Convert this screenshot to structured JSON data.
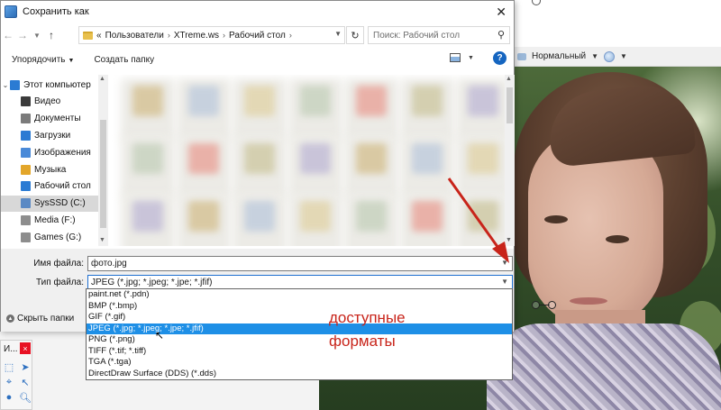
{
  "dialog": {
    "title": "Сохранить как",
    "address": {
      "crumbs": [
        "«",
        "Пользователи",
        "XTreme.ws",
        "Рабочий стол"
      ]
    },
    "search_placeholder": "Поиск: Рабочий стол",
    "toolbar": {
      "organize_label": "Упорядочить",
      "new_folder_label": "Создать папку"
    },
    "nav_items": [
      {
        "label": "Этот компьютер",
        "icon": "computer-icon",
        "color": "#2b7bd3"
      },
      {
        "label": "Видео",
        "icon": "video-folder-icon",
        "color": "#3b3b3b"
      },
      {
        "label": "Документы",
        "icon": "documents-folder-icon",
        "color": "#7b7b7b"
      },
      {
        "label": "Загрузки",
        "icon": "downloads-folder-icon",
        "color": "#2b7bd3"
      },
      {
        "label": "Изображения",
        "icon": "pictures-folder-icon",
        "color": "#4a8ad8"
      },
      {
        "label": "Музыка",
        "icon": "music-folder-icon",
        "color": "#e3a62a"
      },
      {
        "label": "Рабочий стол",
        "icon": "desktop-folder-icon",
        "color": "#2b7bd3"
      },
      {
        "label": "SysSSD (C:)",
        "icon": "system-drive-icon",
        "color": "#5a89c4"
      },
      {
        "label": "Media (F:)",
        "icon": "drive-icon",
        "color": "#8d8d8d"
      },
      {
        "label": "Games (G:)",
        "icon": "drive-icon",
        "color": "#8d8d8d"
      }
    ],
    "form": {
      "filename_label": "Имя файла:",
      "filename_value": "фото.jpg",
      "filetype_label": "Тип файла:",
      "filetype_value": "JPEG (*.jpg; *.jpeg; *.jpe; *.jfif)",
      "hide_folders_label": "Скрыть папки"
    },
    "filetype_options": [
      {
        "label": "paint.net (*.pdn)",
        "highlighted": false
      },
      {
        "label": "BMP (*.bmp)",
        "highlighted": false
      },
      {
        "label": "GIF (*.gif)",
        "highlighted": false
      },
      {
        "label": "JPEG (*.jpg; *.jpeg; *.jpe; *.jfif)",
        "highlighted": true
      },
      {
        "label": "PNG (*.png)",
        "highlighted": false
      },
      {
        "label": "TIFF (*.tif; *.tiff)",
        "highlighted": false
      },
      {
        "label": "TGA (*.tga)",
        "highlighted": false
      },
      {
        "label": "DirectDraw Surface (DDS) (*.dds)",
        "highlighted": false
      }
    ]
  },
  "background_app": {
    "blend_mode_label": "Нормальный",
    "tools_window_title": "И...",
    "tools_close": "×"
  },
  "annotation": {
    "line1": "доступные",
    "line2": "форматы",
    "color": "#c8241a"
  },
  "colors": {
    "highlight": "#1e8fe6",
    "help_button": "#1565c0",
    "close_red": "#e81123"
  }
}
